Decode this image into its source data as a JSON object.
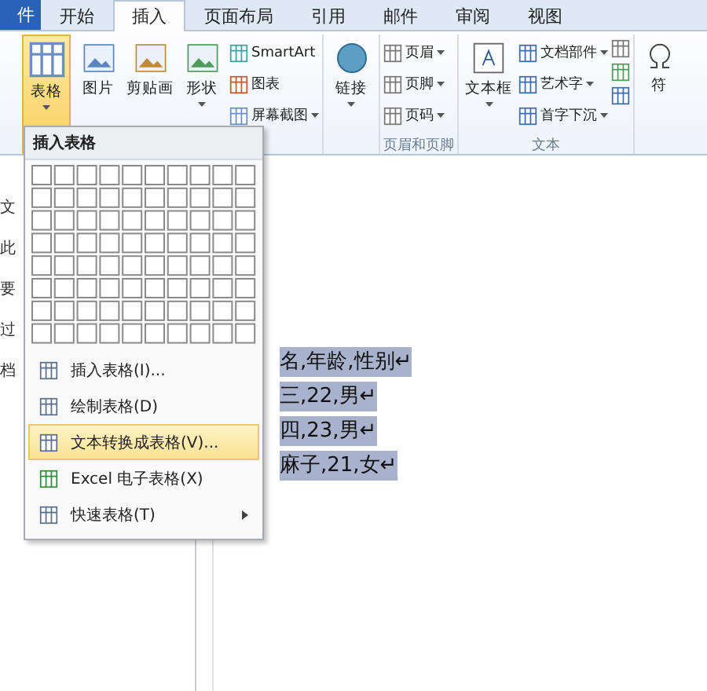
{
  "file_tab": "件",
  "tabs": [
    {
      "label": "开始",
      "selected": false
    },
    {
      "label": "插入",
      "selected": true
    },
    {
      "label": "页面布局",
      "selected": false
    },
    {
      "label": "引用",
      "selected": false
    },
    {
      "label": "邮件",
      "selected": false
    },
    {
      "label": "审阅",
      "selected": false
    },
    {
      "label": "视图",
      "selected": false
    }
  ],
  "ribbon": {
    "table_button": {
      "label": "表格",
      "pressed": true
    },
    "illustrations": [
      {
        "label": "图片",
        "dropdown": false
      },
      {
        "label": "剪贴画",
        "dropdown": false
      },
      {
        "label": "形状",
        "dropdown": true
      }
    ],
    "small_items": [
      {
        "label": "SmartArt",
        "dropdown": false
      },
      {
        "label": "图表",
        "dropdown": false
      },
      {
        "label": "屏幕截图",
        "dropdown": true
      }
    ],
    "links_button": {
      "label": "链接",
      "dropdown": true
    },
    "header_footer": {
      "label": "页眉和页脚",
      "items": [
        {
          "label": "页眉",
          "dropdown": true
        },
        {
          "label": "页脚",
          "dropdown": true
        },
        {
          "label": "页码",
          "dropdown": true
        }
      ]
    },
    "text_group": {
      "label": "文本",
      "large_button": "文本框",
      "items": [
        {
          "label": "文档部件",
          "dropdown": true
        },
        {
          "label": "艺术字",
          "dropdown": true
        },
        {
          "label": "首字下沉",
          "dropdown": true
        }
      ]
    },
    "symbols_partial": "符"
  },
  "left_pane": [
    "文",
    "此",
    "要",
    "过",
    "档"
  ],
  "menu": {
    "title": "插入表格",
    "items": [
      {
        "label": "插入表格(I)...",
        "selected": false,
        "submenu": false
      },
      {
        "label": "绘制表格(D)",
        "selected": false,
        "submenu": false
      },
      {
        "label": "文本转换成表格(V)...",
        "selected": true,
        "submenu": false
      },
      {
        "label": "Excel 电子表格(X)",
        "selected": false,
        "submenu": false
      },
      {
        "label": "快速表格(T)",
        "selected": false,
        "submenu": true
      }
    ]
  },
  "document": {
    "lines": [
      {
        "text": "名,年龄,性别↵",
        "selected": true
      },
      {
        "text": "三,22,男↵",
        "selected": true
      },
      {
        "text": "四,23,男↵",
        "selected": true
      },
      {
        "text": "麻子,21,女↵",
        "selected": true
      }
    ]
  }
}
